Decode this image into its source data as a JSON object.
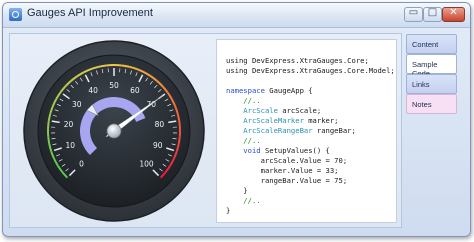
{
  "window": {
    "title": "Gauges API Improvement"
  },
  "title_buttons": {
    "minimize": "▭",
    "maximize": "□",
    "close": "✕"
  },
  "gauge": {
    "tick_labels": [
      "0",
      "10",
      "20",
      "30",
      "40",
      "50",
      "60",
      "70",
      "80",
      "90",
      "100"
    ],
    "arc_scale_value": 70,
    "marker_value": 33,
    "range_bar_value": 75,
    "colors": {
      "bezel": "#3c4249",
      "face": "#23282d",
      "range_bar": "#a8a6f0",
      "needle": "#ffffff"
    }
  },
  "code": [
    [
      {
        "t": "using DevExpress.XtraGauges.Core;",
        "c": ""
      }
    ],
    [
      {
        "t": "using DevExpress.XtraGauges.Core.Model;",
        "c": ""
      }
    ],
    [
      {
        "t": "",
        "c": ""
      }
    ],
    [
      {
        "t": "namespace",
        "c": "kw"
      },
      {
        "t": " GaugeApp {",
        "c": ""
      }
    ],
    [
      {
        "t": "    //..",
        "c": "cm"
      }
    ],
    [
      {
        "t": "    ArcScale",
        "c": "ty"
      },
      {
        "t": " arcScale;",
        "c": ""
      }
    ],
    [
      {
        "t": "    ArcScaleMarker",
        "c": "ty"
      },
      {
        "t": " marker;",
        "c": ""
      }
    ],
    [
      {
        "t": "    ArcScaleRangeBar",
        "c": "ty"
      },
      {
        "t": " rangeBar;",
        "c": ""
      }
    ],
    [
      {
        "t": "    //..",
        "c": "cm"
      }
    ],
    [
      {
        "t": "    void",
        "c": "kw"
      },
      {
        "t": " SetupValues() {",
        "c": ""
      }
    ],
    [
      {
        "t": "        arcScale.Value = 70;",
        "c": ""
      }
    ],
    [
      {
        "t": "        marker.Value = 33;",
        "c": ""
      }
    ],
    [
      {
        "t": "        rangeBar.Value = 75;",
        "c": ""
      }
    ],
    [
      {
        "t": "    }",
        "c": ""
      }
    ],
    [
      {
        "t": "    //..",
        "c": "cm"
      }
    ],
    [
      {
        "t": "}",
        "c": ""
      }
    ]
  ],
  "nav": {
    "items": [
      "Content",
      "Sample Code",
      "Links",
      "Notes"
    ],
    "active": "Sample Code"
  }
}
